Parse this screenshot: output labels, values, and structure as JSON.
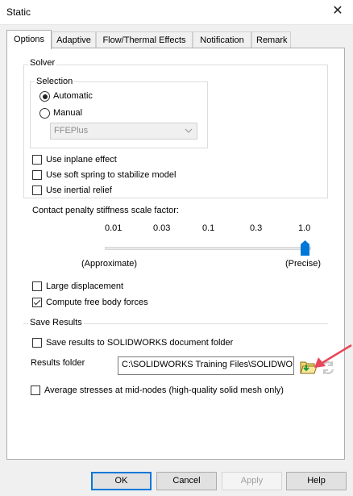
{
  "window": {
    "title": "Static",
    "close_glyph": "✕"
  },
  "tabs": [
    {
      "label": "Options",
      "active": true
    },
    {
      "label": "Adaptive"
    },
    {
      "label": "Flow/Thermal Effects"
    },
    {
      "label": "Notification"
    },
    {
      "label": "Remark"
    }
  ],
  "solver": {
    "group_label": "Solver",
    "selection_label": "Selection",
    "automatic_label": "Automatic",
    "manual_label": "Manual",
    "selected": "Automatic",
    "solver_select_value": "FFEPlus",
    "options": [
      {
        "label": "Use inplane effect",
        "checked": false
      },
      {
        "label": "Use soft spring to stabilize model",
        "checked": false
      },
      {
        "label": "Use inertial relief",
        "checked": false
      }
    ]
  },
  "contact_penalty": {
    "label": "Contact penalty stiffness scale factor:",
    "ticks": [
      "0.01",
      "0.03",
      "0.1",
      "0.3",
      "1.0"
    ],
    "min_label": "(Approximate)",
    "max_label": "(Precise)",
    "value": "1.0",
    "accent_color": "#0078d7"
  },
  "other_options": [
    {
      "label": "Large displacement",
      "checked": false
    },
    {
      "label": "Compute free body forces",
      "checked": true
    }
  ],
  "save_results": {
    "group_label": "Save Results",
    "save_to_document_label": "Save results to SOLIDWORKS document folder",
    "save_to_document_checked": false,
    "results_folder_label": "Results folder",
    "results_folder_value": "C:\\SOLIDWORKS Training Files\\SOLIDWORKS",
    "browse_icon": "folder-open-icon",
    "refresh_icon": "refresh-icon",
    "average_stresses_label": "Average stresses at mid-nodes (high-quality solid mesh only)",
    "average_stresses_checked": false
  },
  "buttons": {
    "ok": "OK",
    "cancel": "Cancel",
    "apply": "Apply",
    "help": "Help"
  },
  "annotation": {
    "arrow_color": "#e8465a"
  }
}
